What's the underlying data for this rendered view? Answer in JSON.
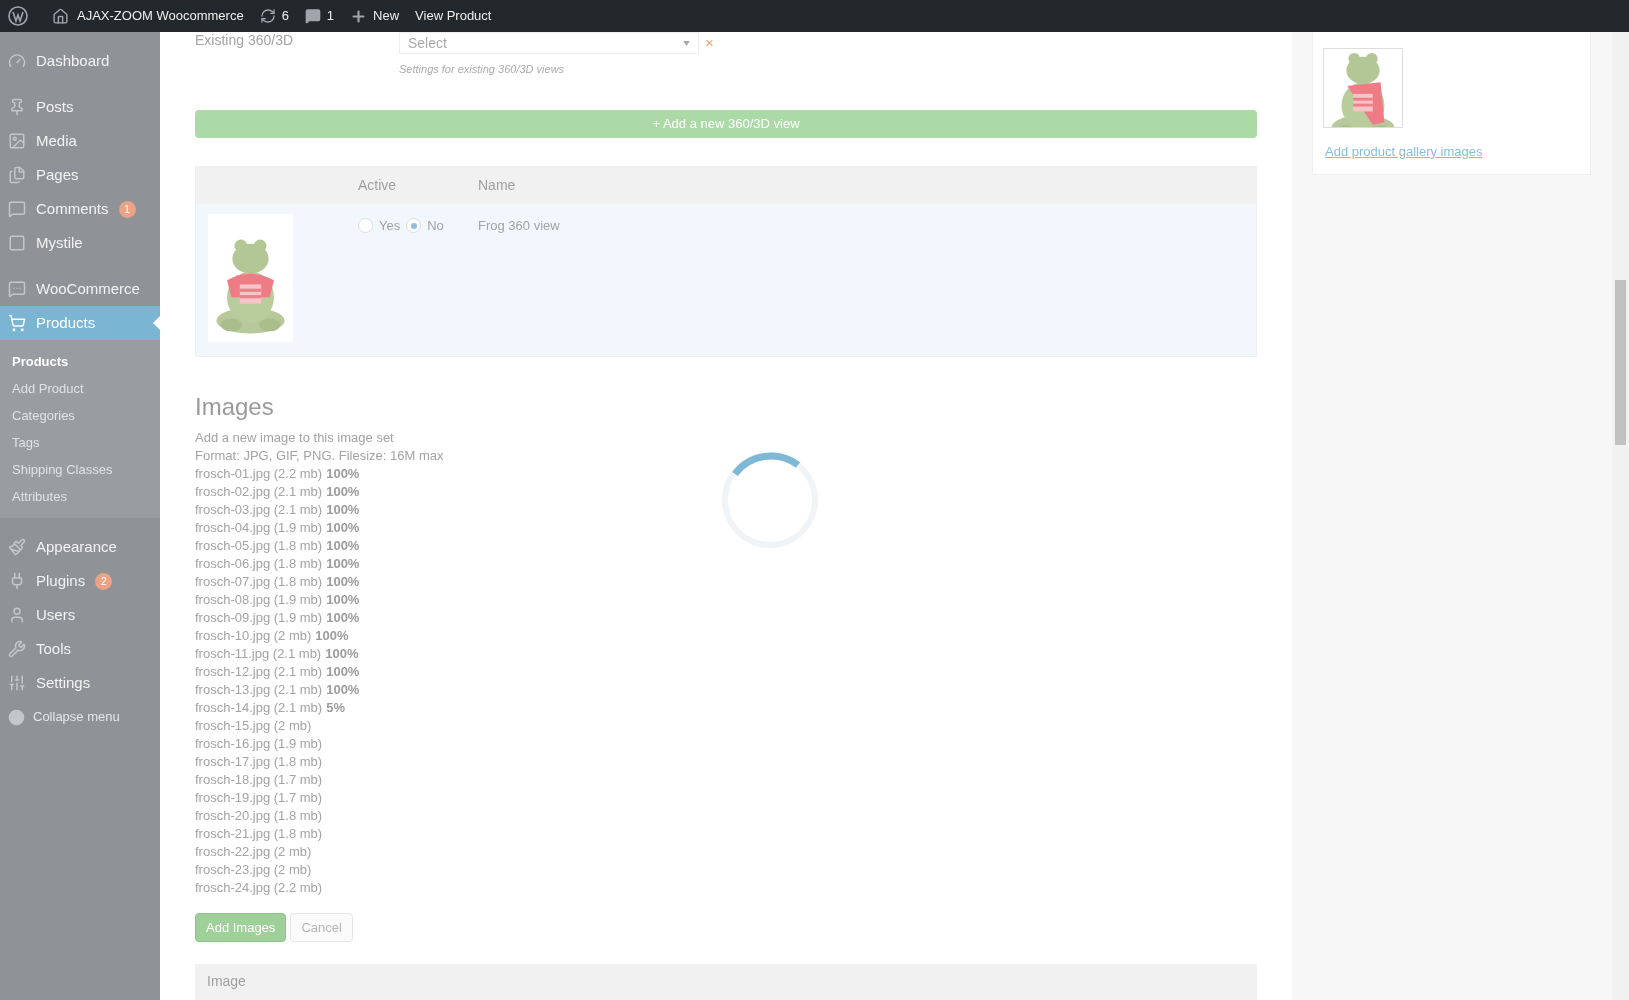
{
  "admin_bar": {
    "site_name": "AJAX-ZOOM Woocommerce",
    "updates": "6",
    "comments": "1",
    "new": "New",
    "view": "View Product"
  },
  "sidebar": {
    "items": [
      {
        "label": "Dashboard",
        "selected": false
      },
      {
        "label": "Posts",
        "selected": false
      },
      {
        "label": "Media",
        "selected": false
      },
      {
        "label": "Pages",
        "selected": false
      },
      {
        "label": "Comments",
        "selected": false,
        "badge": "1"
      },
      {
        "label": "Mystile",
        "selected": false
      },
      {
        "label": "WooCommerce",
        "selected": false
      },
      {
        "label": "Products",
        "selected": true,
        "children": [
          {
            "label": "Products",
            "selected": true
          },
          {
            "label": "Add Product",
            "selected": false
          },
          {
            "label": "Categories",
            "selected": false
          },
          {
            "label": "Tags",
            "selected": false
          },
          {
            "label": "Shipping Classes",
            "selected": false
          },
          {
            "label": "Attributes",
            "selected": false
          }
        ]
      },
      {
        "label": "Appearance",
        "selected": false
      },
      {
        "label": "Plugins",
        "selected": false,
        "badge": "2"
      },
      {
        "label": "Users",
        "selected": false
      },
      {
        "label": "Tools",
        "selected": false
      },
      {
        "label": "Settings",
        "selected": false
      }
    ],
    "collapse": "Collapse menu"
  },
  "existing": {
    "label": "Existing 360/3D",
    "value": "Select",
    "hint": "Settings for existing 360/3D views",
    "clear": "×"
  },
  "add_view_button": "+ Add a new 360/3D view",
  "views_table": {
    "columns": [
      "Active",
      "Name"
    ],
    "rows": [
      {
        "options": [
          {
            "label": "Yes",
            "selected": false
          },
          {
            "label": "No",
            "selected": true
          }
        ],
        "name": "Frog 360 view"
      }
    ]
  },
  "images": {
    "title": "Images",
    "intro": "Add a new image to this image set",
    "format": "Format: JPG, GIF, PNG. Filesize: 16M max",
    "files": [
      {
        "name": "frosch-01.jpg (2.2 mb)",
        "progress": "100%"
      },
      {
        "name": "frosch-02.jpg (2.1 mb)",
        "progress": "100%"
      },
      {
        "name": "frosch-03.jpg (2.1 mb)",
        "progress": "100%"
      },
      {
        "name": "frosch-04.jpg (1.9 mb)",
        "progress": "100%"
      },
      {
        "name": "frosch-05.jpg (1.8 mb)",
        "progress": "100%"
      },
      {
        "name": "frosch-06.jpg (1.8 mb)",
        "progress": "100%"
      },
      {
        "name": "frosch-07.jpg (1.8 mb)",
        "progress": "100%"
      },
      {
        "name": "frosch-08.jpg (1.9 mb)",
        "progress": "100%"
      },
      {
        "name": "frosch-09.jpg (1.9 mb)",
        "progress": "100%"
      },
      {
        "name": "frosch-10.jpg (2 mb)",
        "progress": "100%"
      },
      {
        "name": "frosch-11.jpg (2.1 mb)",
        "progress": "100%"
      },
      {
        "name": "frosch-12.jpg (2.1 mb)",
        "progress": "100%"
      },
      {
        "name": "frosch-13.jpg (2.1 mb)",
        "progress": "100%"
      },
      {
        "name": "frosch-14.jpg (2.1 mb)",
        "progress": "5%"
      },
      {
        "name": "frosch-15.jpg (2 mb)"
      },
      {
        "name": "frosch-16.jpg (1.9 mb)"
      },
      {
        "name": "frosch-17.jpg (1.8 mb)"
      },
      {
        "name": "frosch-18.jpg (1.7 mb)"
      },
      {
        "name": "frosch-19.jpg (1.7 mb)"
      },
      {
        "name": "frosch-20.jpg (1.8 mb)"
      },
      {
        "name": "frosch-21.jpg (1.8 mb)"
      },
      {
        "name": "frosch-22.jpg (2 mb)"
      },
      {
        "name": "frosch-23.jpg (2 mb)"
      },
      {
        "name": "frosch-24.jpg (2.2 mb)"
      }
    ],
    "buttons": [
      {
        "label": "Add Images",
        "kind": "primary"
      },
      {
        "label": "Cancel",
        "kind": "secondary"
      }
    ]
  },
  "image_table": {
    "columns": [
      "Image"
    ]
  },
  "gallery": {
    "link": "Add product gallery images"
  }
}
